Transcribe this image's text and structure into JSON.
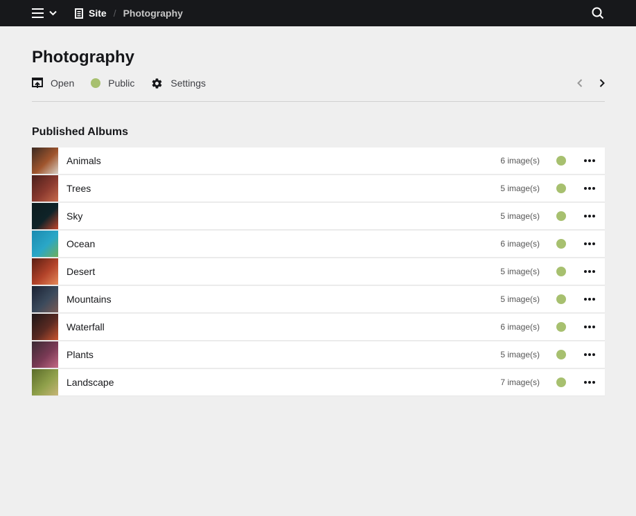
{
  "topbar": {
    "menu_icon": "hamburger-icon",
    "dropdown_icon": "chevron-down-icon",
    "breadcrumb": [
      {
        "label": "Site",
        "icon": "page-icon"
      },
      {
        "label": "Photography"
      }
    ],
    "search_icon": "search-icon"
  },
  "page": {
    "title": "Photography"
  },
  "toolbar": {
    "open_label": "Open",
    "status_label": "Public",
    "settings_label": "Settings",
    "status_color": "#a7c06f"
  },
  "albums_section": {
    "title": "Published Albums",
    "items": [
      {
        "name": "Animals",
        "count": "6 image(s)",
        "thumb_colors": [
          "#3b2a22",
          "#a0552d",
          "#d9d0c5"
        ]
      },
      {
        "name": "Trees",
        "count": "5 image(s)",
        "thumb_colors": [
          "#4a1e1a",
          "#8b3a2f",
          "#c86b4c"
        ]
      },
      {
        "name": "Sky",
        "count": "5 image(s)",
        "thumb_colors": [
          "#0c1c1f",
          "#0f2328",
          "#c2452a"
        ]
      },
      {
        "name": "Ocean",
        "count": "6 image(s)",
        "thumb_colors": [
          "#1a8ab0",
          "#2aa7c7",
          "#6fae5a"
        ]
      },
      {
        "name": "Desert",
        "count": "5 image(s)",
        "thumb_colors": [
          "#5a1e12",
          "#b3432a",
          "#e58a5a"
        ]
      },
      {
        "name": "Mountains",
        "count": "5 image(s)",
        "thumb_colors": [
          "#1a2233",
          "#3b4a5c",
          "#7a5a55"
        ]
      },
      {
        "name": "Waterfall",
        "count": "6 image(s)",
        "thumb_colors": [
          "#1d1617",
          "#5a2a22",
          "#c9542f"
        ]
      },
      {
        "name": "Plants",
        "count": "5 image(s)",
        "thumb_colors": [
          "#3a2a33",
          "#7a3a55",
          "#c46a85"
        ]
      },
      {
        "name": "Landscape",
        "count": "7 image(s)",
        "thumb_colors": [
          "#5a6b2a",
          "#8fa04a",
          "#c7b577"
        ]
      }
    ],
    "status_color": "#a7c06f",
    "options_icon": "more-horizontal-icon"
  }
}
